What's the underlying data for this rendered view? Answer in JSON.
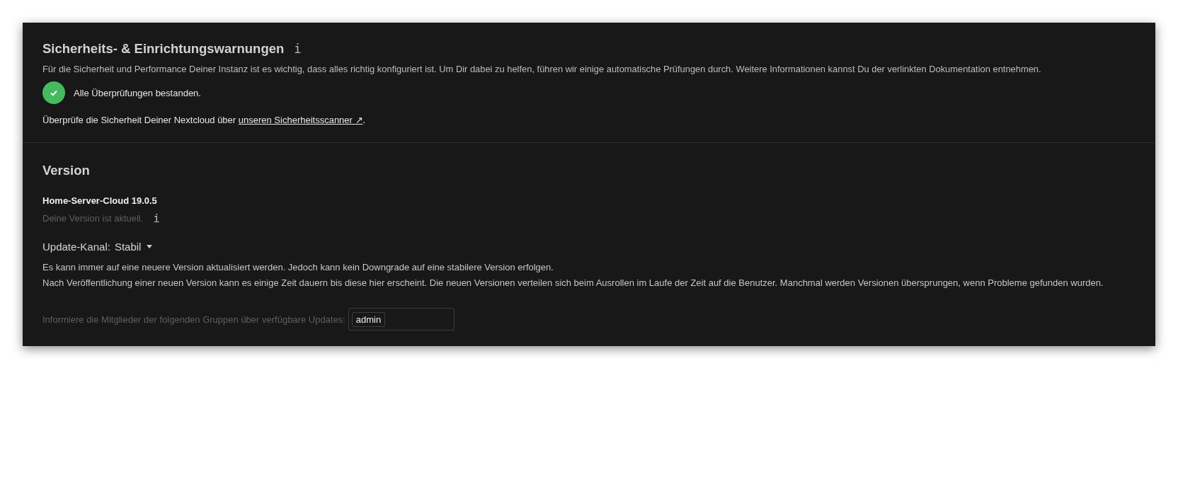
{
  "security": {
    "title": "Sicherheits- & Einrichtungswarnungen",
    "info_icon": "i",
    "description": "Für die Sicherheit und Performance Deiner Instanz ist es wichtig, dass alles richtig konfiguriert ist. Um Dir dabei zu helfen, führen wir einige automatische Prüfungen durch. Weitere Informationen kannst Du der verlinkten Dokumentation entnehmen.",
    "check_result": {
      "passed": true,
      "text": "Alle Überprüfungen bestanden."
    },
    "scanner_text": "Überprüfe die Sicherheit Deiner Nextcloud über ",
    "scanner_link": "unseren Sicherheitsscanner ↗",
    "scanner_end": "."
  },
  "version": {
    "title": "Version",
    "name": "Home-Server-Cloud 19.0.5",
    "status": "Deine Version ist aktuell.",
    "info_icon": "i",
    "channel_label": "Update-Kanal:",
    "channel_value": "Stabil",
    "notes": [
      "Es kann immer auf eine neuere Version aktualisiert werden. Jedoch kann kein Downgrade auf eine stabilere Version erfolgen.",
      "Nach Veröffentlichung einer neuen Version kann es einige Zeit dauern bis diese hier erscheint. Die neuen Versionen verteilen sich beim Ausrollen im Laufe der Zeit auf die Benutzer. Manchmal werden Versionen übersprungen, wenn Probleme gefunden wurden."
    ],
    "notify_label": "Informiere die Mitglieder der folgenden Gruppen über verfügbare Updates:",
    "notify_groups": [
      "admin"
    ]
  }
}
